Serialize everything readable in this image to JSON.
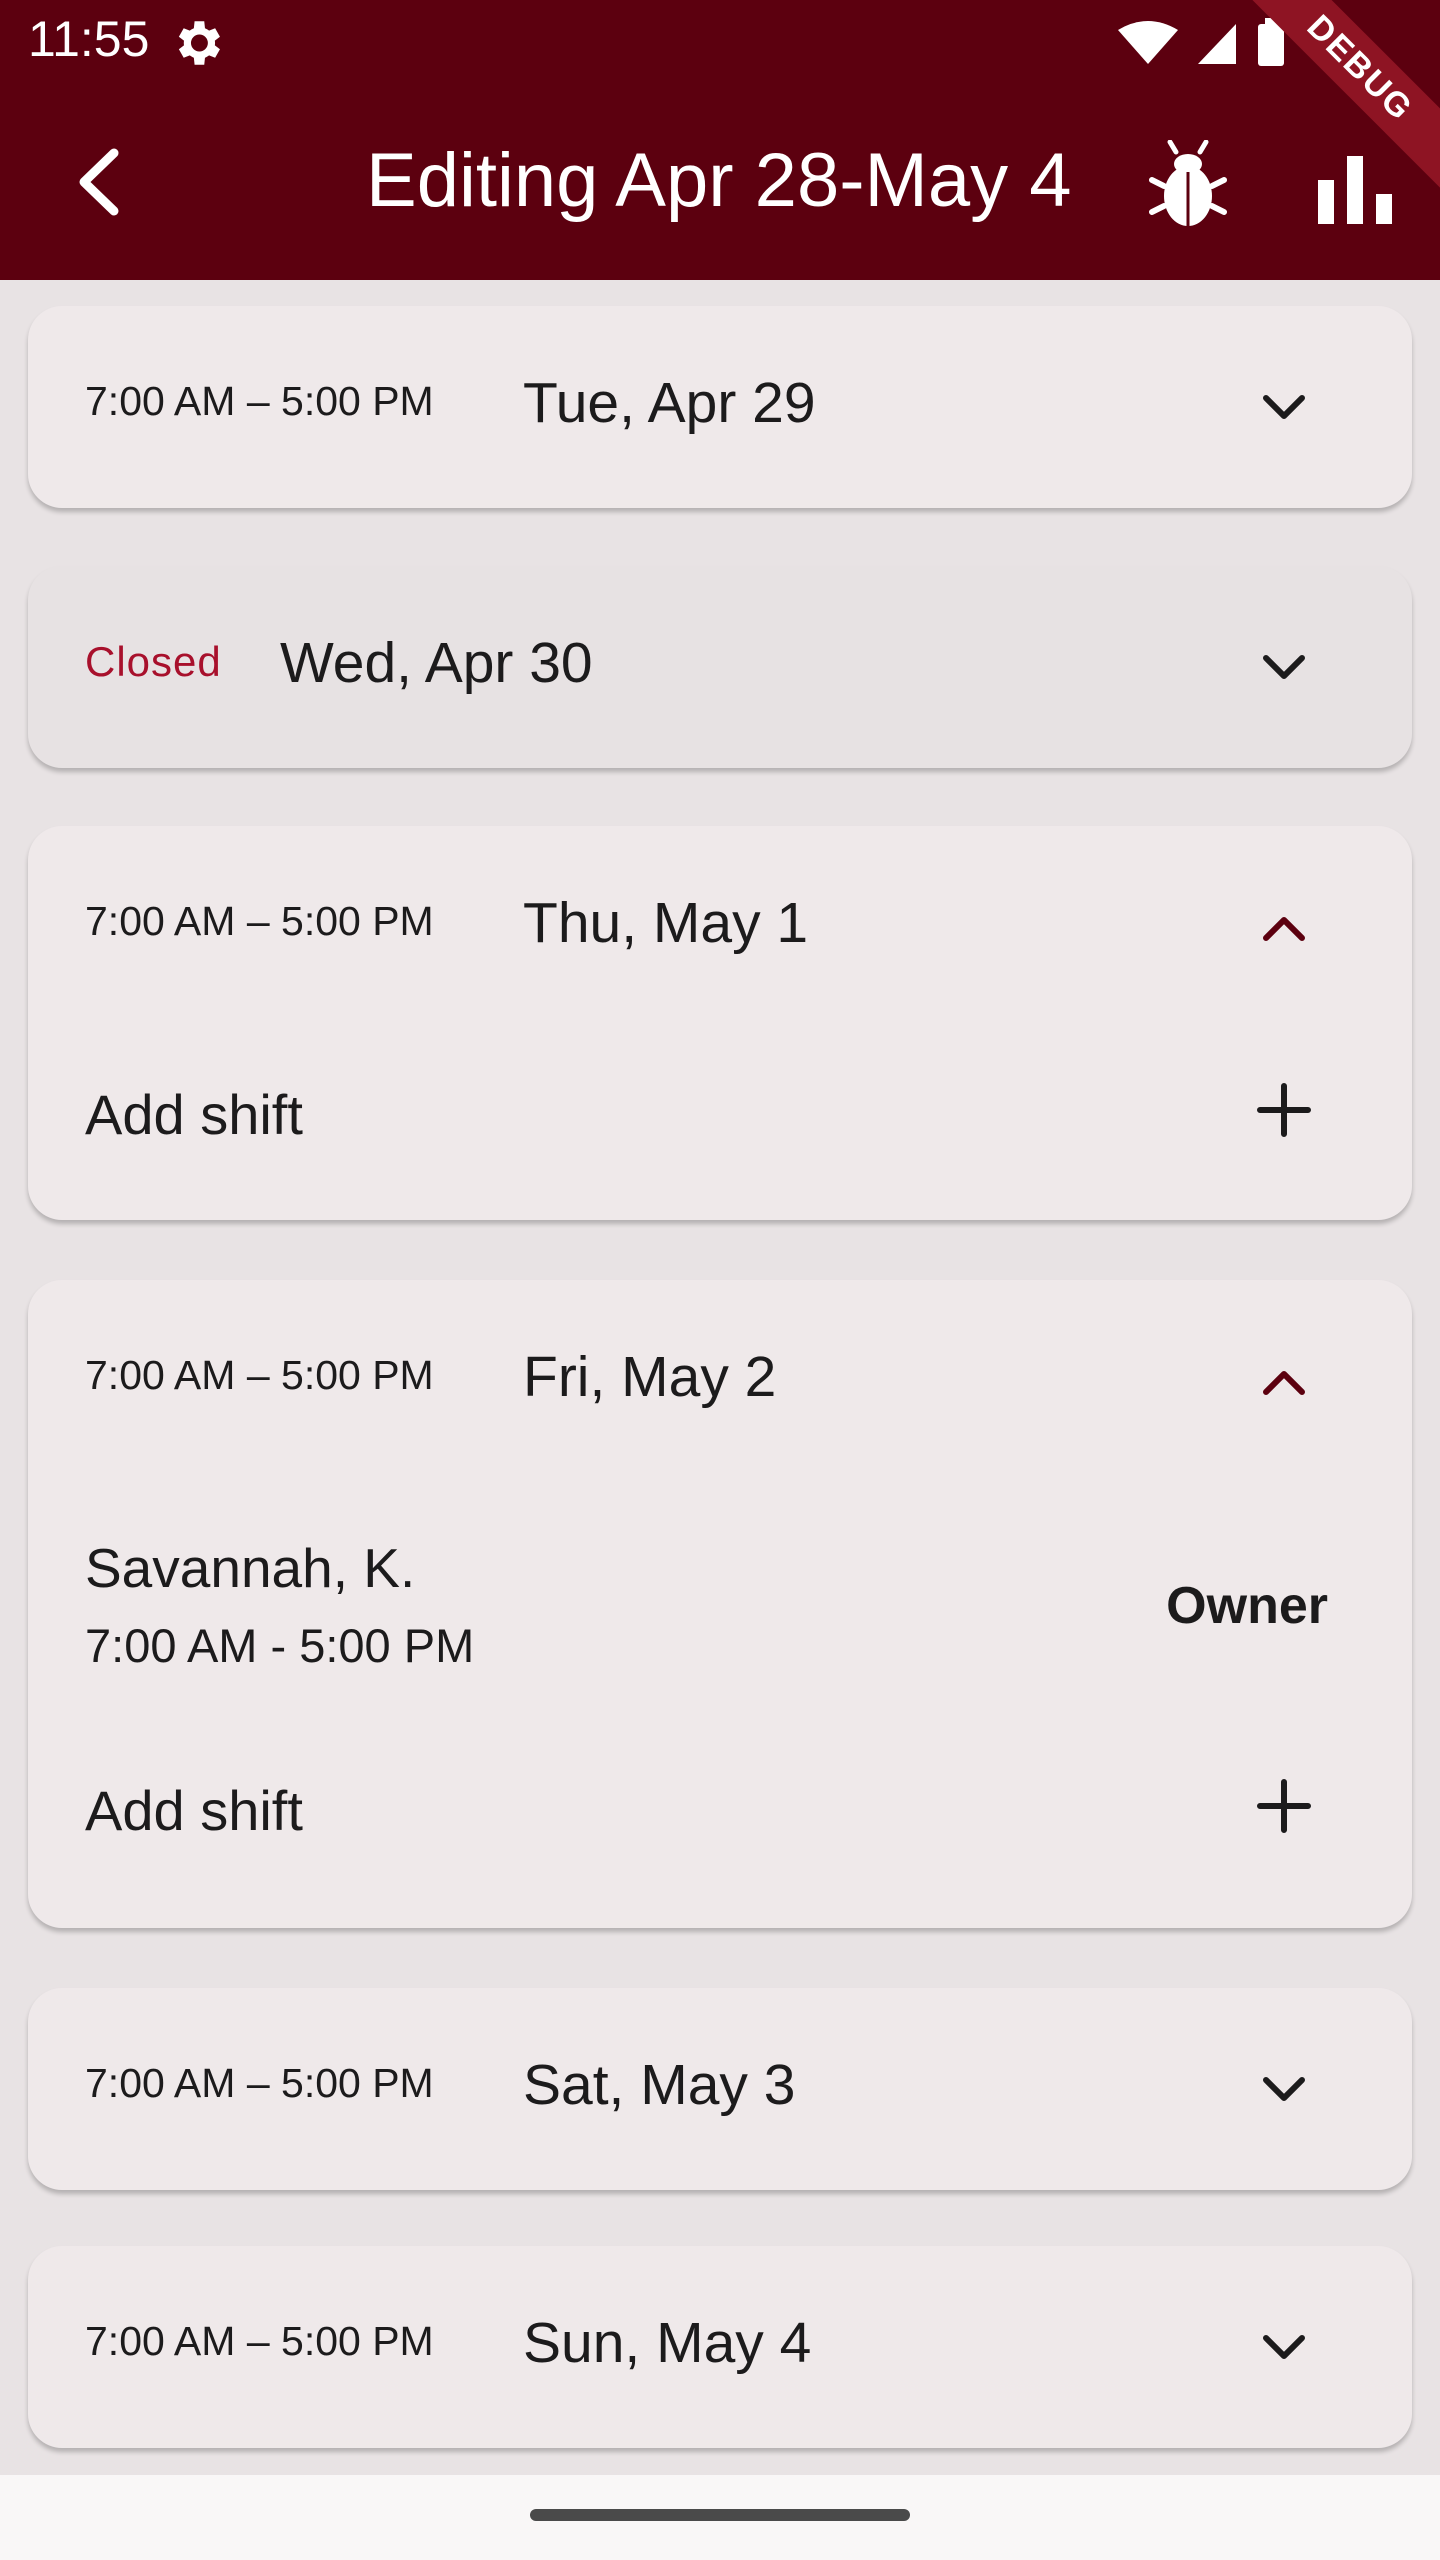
{
  "status_bar": {
    "time": "11:55"
  },
  "debug_banner": "DEBUG",
  "app_bar": {
    "title": "Editing Apr 28-May 4",
    "back_icon": "back-arrow-icon",
    "bug_icon": "bug-icon",
    "chart_icon": "bar-chart-icon"
  },
  "colors": {
    "app_bar": "#5c000f",
    "closed_text": "#a8102c",
    "expanded_chevron": "#5c000f",
    "card": "#efe9ea",
    "background": "#e8e3e4"
  },
  "days": [
    {
      "hours": "7:00 AM – 5:00 PM",
      "label": "Tue, Apr 29",
      "expanded": false
    },
    {
      "hours": "Closed",
      "label": "Wed, Apr 30",
      "expanded": false,
      "closed": true
    },
    {
      "hours": "7:00 AM – 5:00 PM",
      "label": "Thu, May 1",
      "expanded": true,
      "add_shift": "Add shift"
    },
    {
      "hours": "7:00 AM – 5:00 PM",
      "label": "Fri, May 2",
      "expanded": true,
      "shifts": [
        {
          "name": "Savannah, K.",
          "time": "7:00 AM - 5:00 PM",
          "role": "Owner"
        }
      ],
      "add_shift": "Add shift"
    },
    {
      "hours": "7:00 AM – 5:00 PM",
      "label": "Sat, May 3",
      "expanded": false
    },
    {
      "hours": "7:00 AM – 5:00 PM",
      "label": "Sun, May 4",
      "expanded": false
    }
  ]
}
